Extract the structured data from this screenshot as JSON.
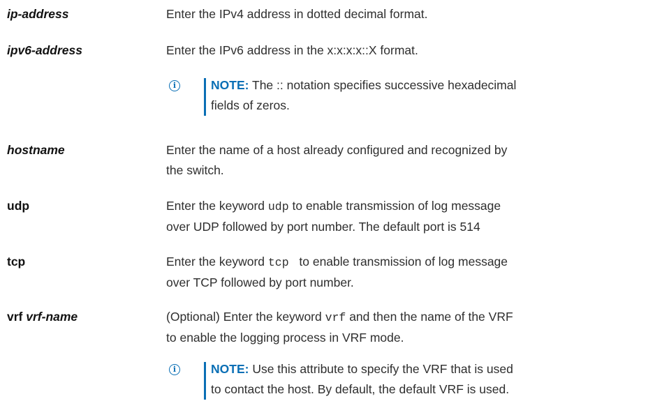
{
  "rows": [
    {
      "param": "ip-address",
      "desc": "Enter the IPv4 address in dotted decimal format."
    },
    {
      "param": "ipv6-address",
      "desc": "Enter the IPv6 address in the x:x:x:x::X format."
    },
    {
      "param": "hostname",
      "desc_lines": [
        "Enter the name of a host already configured and recognized by",
        "the switch."
      ]
    },
    {
      "param": "udp",
      "desc_pre": "Enter the keyword ",
      "keyword": "udp",
      "desc_post": " to enable transmission of log message",
      "desc_line2": "over UDP followed by port number. The default port is 514"
    },
    {
      "param": "tcp",
      "desc_pre": "Enter the keyword ",
      "keyword": "tcp ",
      "desc_post": " to enable transmission of log message",
      "desc_line2": "over TCP followed by port number."
    },
    {
      "param_keyword": "vrf",
      "param_arg": "vrf-name",
      "desc_pre": "(Optional) Enter the keyword ",
      "keyword": "vrf",
      "desc_post": " and then the name of the VRF",
      "desc_line2": "to enable the logging process in VRF mode."
    }
  ],
  "notes": [
    {
      "label": "NOTE:",
      "line1": " The :: notation specifies successive hexadecimal",
      "line2": "fields of zeros."
    },
    {
      "label": "NOTE:",
      "line1": " Use this attribute to specify the VRF that is used",
      "line2": "to contact the host. By default, the default VRF is used."
    }
  ],
  "colors": {
    "accent": "#0a6fb5",
    "text": "#2e2e2e"
  },
  "icons": [
    "info-icon"
  ]
}
